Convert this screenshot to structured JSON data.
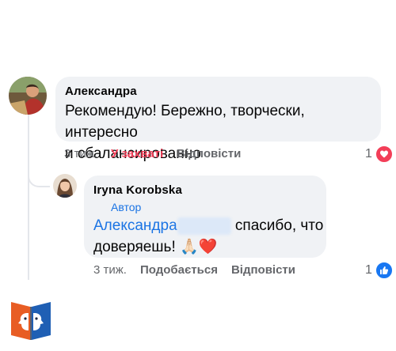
{
  "comments": [
    {
      "author": "Александра",
      "text_line1": "Рекомендую! Бережно, творчески, интересно",
      "text_line2": "и сбалансированно",
      "time": "3 тиж.",
      "reaction_label": "У захваті",
      "reply_label": "Відповісти",
      "reaction_count": "1",
      "reaction_icon": "heart-icon"
    },
    {
      "author": "Iryna  Korobska",
      "badge": "Автор",
      "mention": "Александра",
      "text_after_mention": " спасибо, что",
      "text_line2": "доверяешь!",
      "emojis": "🙏🏻❤️",
      "time": "3 тиж.",
      "like_label": "Подобається",
      "reply_label": "Відповісти",
      "reaction_count": "1",
      "reaction_icon": "like-icon"
    }
  ],
  "colors": {
    "bubble": "#f0f2f5",
    "link": "#1b74e4",
    "love": "#f33e58",
    "like": "#1877f2",
    "muted": "#65676b"
  },
  "logo": "book-face-logo"
}
